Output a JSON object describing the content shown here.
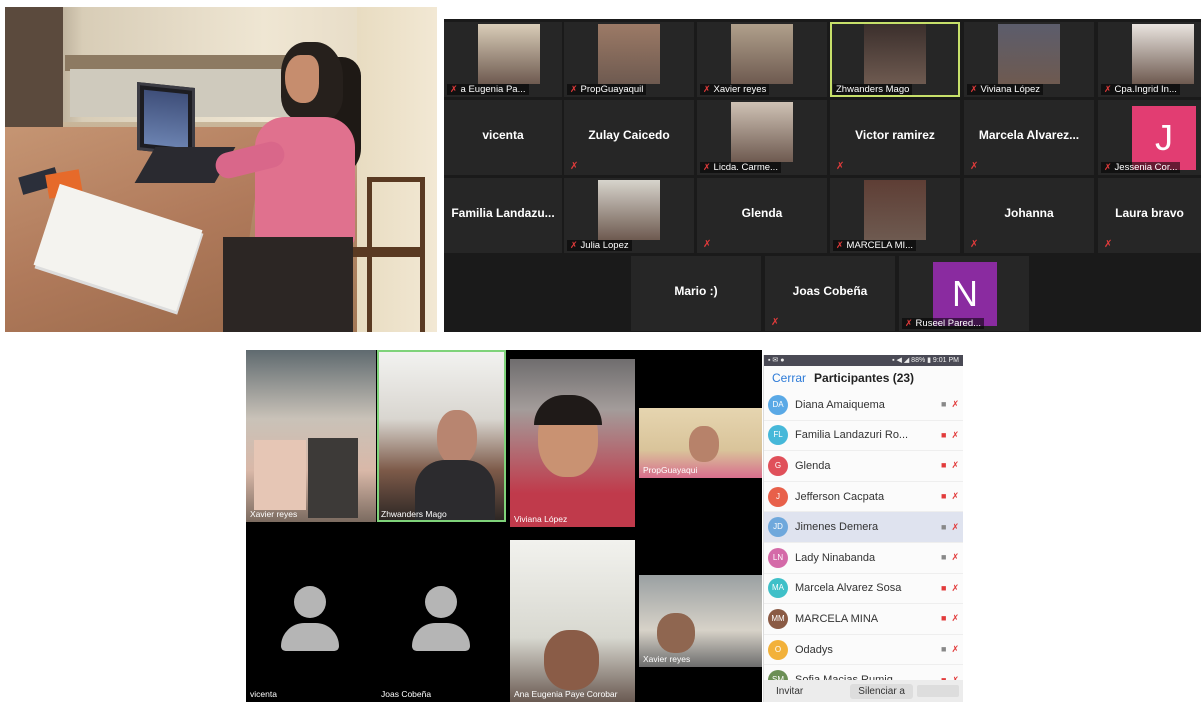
{
  "zoom_grid": {
    "tiles": [
      {
        "name": "a Eugenia Pa...",
        "kind": "video",
        "muted": true
      },
      {
        "name": "PropGuayaquil",
        "kind": "video",
        "muted": true
      },
      {
        "name": "Xavier reyes",
        "kind": "video",
        "muted": true
      },
      {
        "name": "Zhwanders Mago",
        "kind": "video",
        "muted": false,
        "active": true
      },
      {
        "name": "Viviana López",
        "kind": "video",
        "muted": true
      },
      {
        "name": "Cpa.Ingrid In...",
        "kind": "video",
        "muted": true
      },
      {
        "name": "vicenta",
        "kind": "name",
        "muted": false
      },
      {
        "name": "Zulay Caicedo",
        "kind": "name",
        "muted": true
      },
      {
        "name": "Licda. Carme...",
        "kind": "video",
        "muted": true
      },
      {
        "name": "Victor ramirez",
        "kind": "name",
        "muted": true
      },
      {
        "name": "Marcela  Alvarez...",
        "kind": "name",
        "muted": true
      },
      {
        "name": "Jessenia Cor...",
        "kind": "letter",
        "letter": "J",
        "color": "#e23d72",
        "muted": true
      },
      {
        "name": "Familia  Landazu...",
        "kind": "name",
        "muted": false
      },
      {
        "name": "Julia Lopez",
        "kind": "video",
        "muted": true
      },
      {
        "name": "Glenda",
        "kind": "name",
        "muted": true
      },
      {
        "name": "MARCELA MI...",
        "kind": "video",
        "muted": true
      },
      {
        "name": "Johanna",
        "kind": "name",
        "muted": true
      },
      {
        "name": "Laura bravo",
        "kind": "name",
        "muted": true
      },
      {
        "name": "Mario :)",
        "kind": "name",
        "muted": false
      },
      {
        "name": "Joas Cobeña",
        "kind": "name",
        "muted": true
      },
      {
        "name": "Ruseel Pared...",
        "kind": "letter",
        "letter": "N",
        "color": "#8a2ba0",
        "muted": true
      }
    ]
  },
  "mobile_gallery": {
    "tiles": [
      {
        "caption": "Xavier reyes"
      },
      {
        "caption": "Zhwanders Mago"
      },
      {
        "caption": "Viviana López"
      },
      {
        "caption": "PropGuayaqui"
      },
      {
        "caption": "vicenta"
      },
      {
        "caption": "Joas Cobeña"
      },
      {
        "caption": "Ana Eugenia Paye Corobar"
      },
      {
        "caption": "Xavier reyes"
      }
    ]
  },
  "participants": {
    "status_left": "▪ ✉ ●",
    "status_right": "▪ ◀ ◢ 88% ▮ 9:01 PM",
    "close_label": "Cerrar",
    "title": "Participantes (23)",
    "rows": [
      {
        "initials": "DA",
        "name": "Diana Amaiquema",
        "color": "#5aa9e6",
        "cam_off": false
      },
      {
        "initials": "FL",
        "name": "Familia Landazuri Ro...",
        "color": "#46b8d9",
        "cam_off": true
      },
      {
        "initials": "G",
        "name": "Glenda",
        "color": "#e0505a",
        "cam_off": true
      },
      {
        "initials": "J",
        "name": "Jefferson  Cacpata",
        "color": "#e8604a",
        "cam_off": true
      },
      {
        "initials": "JD",
        "name": "Jimenes Demera",
        "color": "#6fa8dc",
        "cam_off": false,
        "selected": true
      },
      {
        "initials": "LN",
        "name": "Lady Ninabanda",
        "color": "#d46aa8",
        "cam_off": false
      },
      {
        "initials": "MA",
        "name": "Marcela Alvarez Sosa",
        "color": "#3fc0c8",
        "cam_off": true
      },
      {
        "initials": "MM",
        "name": "MARCELA MINA",
        "color": "#8a5a44",
        "cam_off": true
      },
      {
        "initials": "O",
        "name": "Odadys",
        "color": "#f2b13a",
        "cam_off": false
      },
      {
        "initials": "SM",
        "name": "Sofia Macias Rumig...",
        "color": "#6b8f55",
        "cam_off": true
      }
    ],
    "footer": {
      "invite": "Invitar",
      "mute_all": "Silenciar a"
    }
  }
}
